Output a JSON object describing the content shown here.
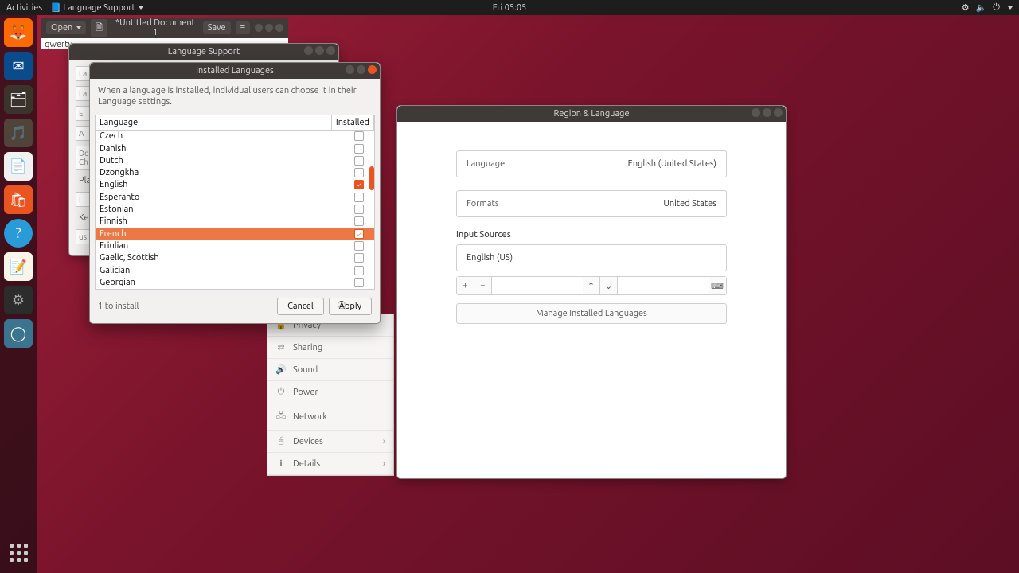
{
  "topbar": {
    "activities": "Activities",
    "app": "Language Support",
    "clock": "Fri 05:05"
  },
  "gedit": {
    "open": "Open",
    "title": "*Untitled Document 1",
    "save": "Save",
    "content": "qwerty"
  },
  "lang_support": {
    "title": "Language Support"
  },
  "installed": {
    "title": "Installed Languages",
    "desc": "When a language is installed, individual users can choose it in their Language settings.",
    "col_lang": "Language",
    "col_inst": "Installed",
    "rows": [
      {
        "name": "Czech",
        "installed": false,
        "sel": false
      },
      {
        "name": "Danish",
        "installed": false,
        "sel": false
      },
      {
        "name": "Dutch",
        "installed": false,
        "sel": false
      },
      {
        "name": "Dzongkha",
        "installed": false,
        "sel": false
      },
      {
        "name": "English",
        "installed": true,
        "sel": false
      },
      {
        "name": "Esperanto",
        "installed": false,
        "sel": false
      },
      {
        "name": "Estonian",
        "installed": false,
        "sel": false
      },
      {
        "name": "Finnish",
        "installed": false,
        "sel": false
      },
      {
        "name": "French",
        "installed": true,
        "sel": true
      },
      {
        "name": "Friulian",
        "installed": false,
        "sel": false
      },
      {
        "name": "Gaelic, Scottish",
        "installed": false,
        "sel": false
      },
      {
        "name": "Galician",
        "installed": false,
        "sel": false
      },
      {
        "name": "Georgian",
        "installed": false,
        "sel": false
      }
    ],
    "count": "1 to install",
    "cancel": "Cancel",
    "apply": "Apply"
  },
  "region": {
    "title": "Region & Language",
    "language_k": "Language",
    "language_v": "English (United States)",
    "formats_k": "Formats",
    "formats_v": "United States",
    "input_title": "Input Sources",
    "input_item": "English (US)",
    "btn_plus": "+",
    "btn_minus": "−",
    "btn_up": "⌃",
    "btn_down": "⌄",
    "btn_kb": "⌨",
    "manage": "Manage Installed Languages"
  },
  "settings_side": [
    {
      "icon": "🔒",
      "label": "Privacy",
      "chev": false
    },
    {
      "icon": "⇄",
      "label": "Sharing",
      "chev": false
    },
    {
      "icon": "🔊",
      "label": "Sound",
      "chev": false
    },
    {
      "icon": "⏻",
      "label": "Power",
      "chev": false
    },
    {
      "icon": "🖧",
      "label": "Network",
      "chev": false
    },
    {
      "icon": "🖱",
      "label": "Devices",
      "chev": true
    },
    {
      "icon": "ℹ",
      "label": "Details",
      "chev": true
    }
  ]
}
